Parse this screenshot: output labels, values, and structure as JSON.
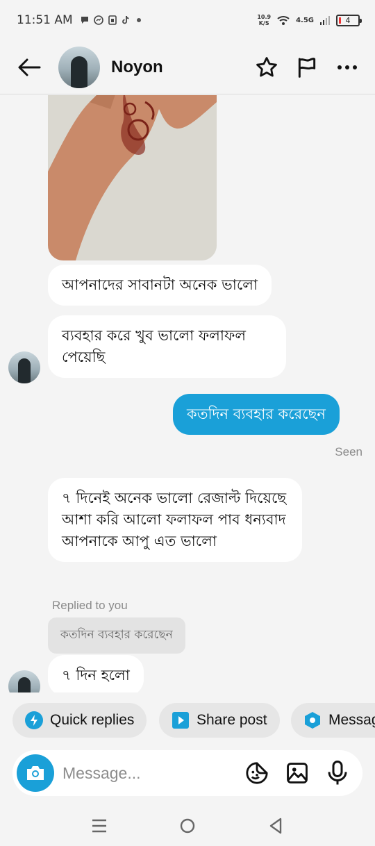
{
  "status_bar": {
    "time": "11:51 AM",
    "net_speed_value": "10.9",
    "net_speed_unit": "K/S",
    "network": "4.5G",
    "battery": "4",
    "notif_icons": [
      "chat-bubble-icon",
      "messenger-icon",
      "sim-icon",
      "tiktok-icon",
      "dot-icon"
    ]
  },
  "header": {
    "contact_name": "Noyon"
  },
  "messages": [
    {
      "id": "m1",
      "direction": "in",
      "text": "আপনাদের সাবানটা অনেক ভালো"
    },
    {
      "id": "m2",
      "direction": "in",
      "text": "ব্যবহার করে খুব ভালো ফলাফল পেয়েছি"
    },
    {
      "id": "m3",
      "direction": "out",
      "text": "কতদিন ব্যবহার করেছেন"
    },
    {
      "id": "m4",
      "direction": "in",
      "text": "৭ দিনেই অনেক ভালো রেজাল্ট দিয়েছে আশা করি আলো ফলাফল পাব ধন্যবাদ  আপনাকে আপু এত ভালো"
    },
    {
      "id": "m5",
      "direction": "in",
      "text": "৭ দিন হলো"
    }
  ],
  "seen_label": "Seen",
  "reply": {
    "label": "Replied to you",
    "quoted": "কতদিন ব্যবহার করেছেন"
  },
  "chips": [
    {
      "label": "Quick replies",
      "icon": "lightning-icon"
    },
    {
      "label": "Share post",
      "icon": "play-icon"
    },
    {
      "label": "Messag",
      "icon": "hexagon-icon"
    }
  ],
  "composer": {
    "placeholder": "Message..."
  },
  "colors": {
    "accent": "#1aa0d8",
    "background": "#f4f4f4",
    "bubble_in": "#ffffff",
    "chip_bg": "#e6e6e6"
  }
}
